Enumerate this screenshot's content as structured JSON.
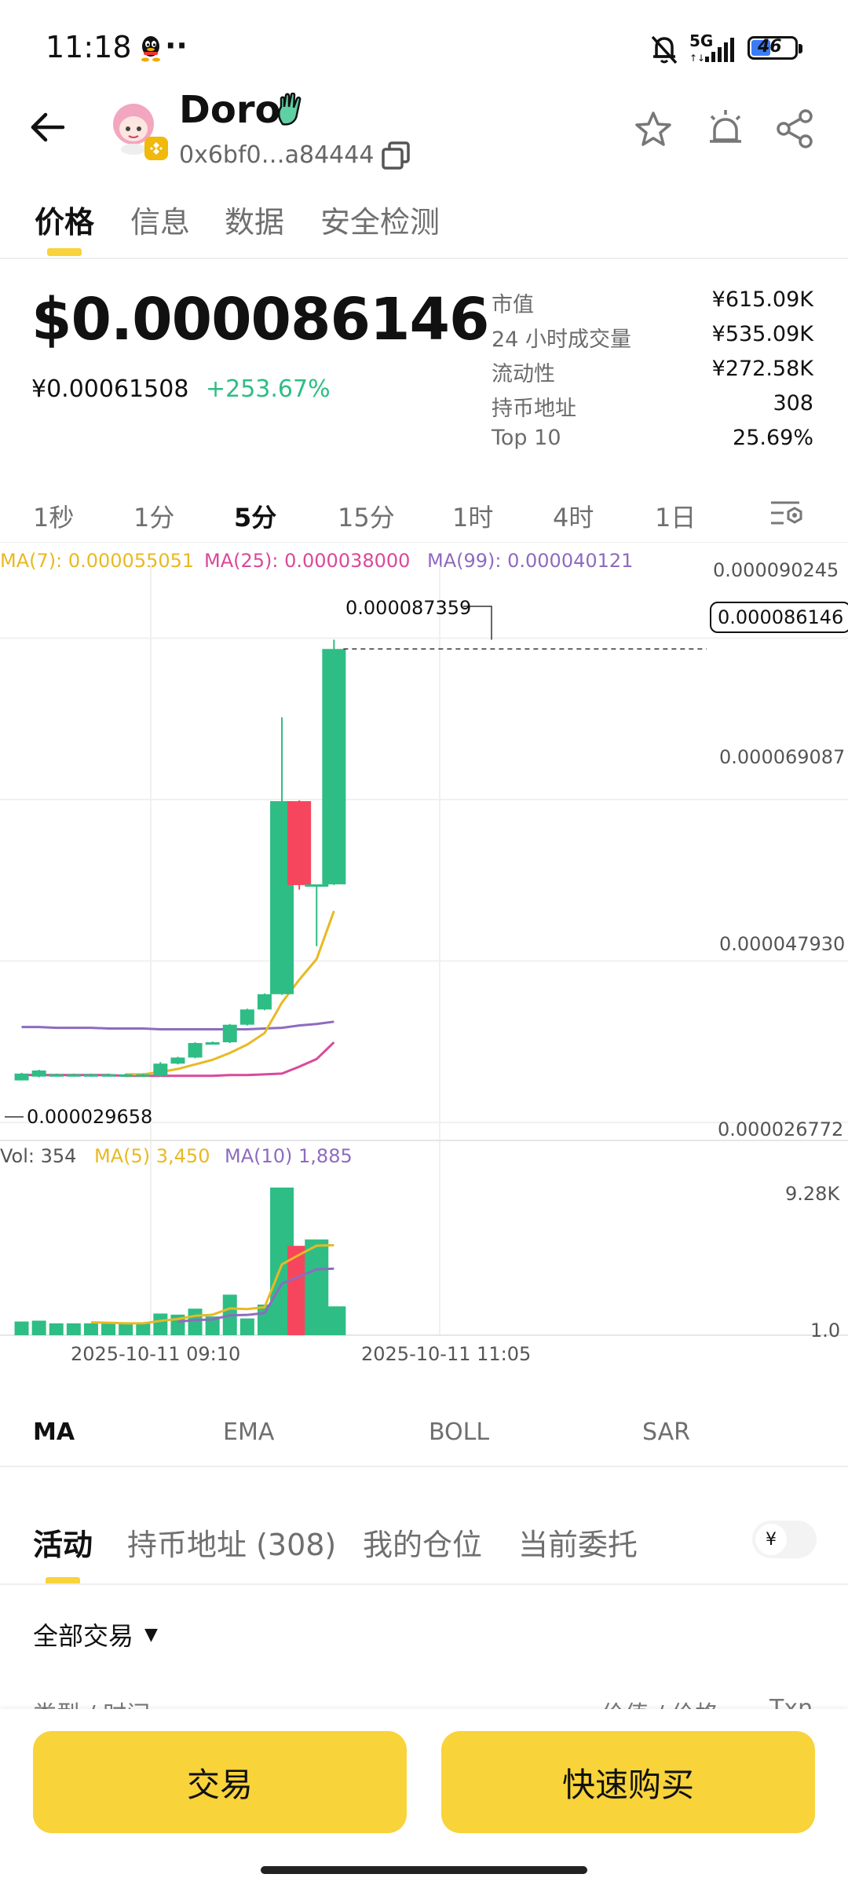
{
  "status_bar": {
    "time": "11:18",
    "dots": "··",
    "signal_label": "5G",
    "battery": "46"
  },
  "header": {
    "title": "Doro",
    "address": "0x6bf0…a84444"
  },
  "tabs": [
    {
      "label": "价格"
    },
    {
      "label": "信息"
    },
    {
      "label": "数据"
    },
    {
      "label": "安全检测"
    }
  ],
  "price": {
    "usd": "$0.000086146",
    "cny": "¥0.00061508",
    "change": "+253.67%"
  },
  "stats": [
    {
      "label": "市值",
      "value": "¥615.09K"
    },
    {
      "label": "24 小时成交量",
      "value": "¥535.09K"
    },
    {
      "label": "流动性",
      "value": "¥272.58K"
    },
    {
      "label": "持币地址",
      "value": "308"
    },
    {
      "label": "Top 10",
      "value": "25.69%"
    }
  ],
  "timeframes": [
    "1秒",
    "1分",
    "5分",
    "15分",
    "1时",
    "4时",
    "1日"
  ],
  "ma_legend": {
    "ma7": "MA(7): 0.000055051",
    "ma25": "MA(25): 0.000038000",
    "ma99": "MA(99): 0.000040121"
  },
  "price_axis": [
    "0.000090245",
    "0.000069087",
    "0.000047930",
    "0.000026772"
  ],
  "chart_annotations": {
    "high": "0.000087359",
    "low": "0.000029658",
    "current": "0.000086146"
  },
  "vol_legend": {
    "vol": "Vol: 354",
    "ma5": "MA(5) 3,450",
    "ma10": "MA(10) 1,885"
  },
  "vol_axis": [
    "9.28K",
    "1.0"
  ],
  "x_axis": [
    "2025-10-11 09:10",
    "2025-10-11 11:05"
  ],
  "indicators": [
    "MA",
    "EMA",
    "BOLL",
    "SAR"
  ],
  "activity_tabs": [
    "活动",
    "持币地址 (308)",
    "我的仓位",
    "当前委托"
  ],
  "currency_toggle": "¥",
  "filter": {
    "label": "全部交易"
  },
  "table_partial": {
    "left": "类型 / 时间",
    "mid": "价值 / 价格",
    "right": "Txn"
  },
  "buttons": {
    "trade": "交易",
    "quick_buy": "快速购买"
  },
  "colors": {
    "up": "#2ebd85",
    "down": "#f6465d",
    "accent": "#f8d33a",
    "ma7": "#e8b923",
    "ma25": "#d9499a",
    "ma99": "#8e6bbf"
  },
  "chart_data": {
    "type": "candlestick",
    "y_axis_ticks": [
      9.0245e-05,
      6.9087e-05,
      4.793e-05,
      2.6772e-05
    ],
    "ylim": [
      2.4e-05,
      9.4e-05
    ],
    "x_labels": [
      "2025-10-11 09:10",
      "2025-10-11 11:05"
    ],
    "candles": [
      {
        "o": 2.96e-05,
        "c": 3.05e-05,
        "h": 3.06e-05,
        "l": 2.96e-05
      },
      {
        "o": 3.01e-05,
        "c": 3.09e-05,
        "h": 3.1e-05,
        "l": 3e-05
      },
      {
        "o": 3.02e-05,
        "c": 3.04e-05,
        "h": 3.05e-05,
        "l": 3.01e-05
      },
      {
        "o": 3.02e-05,
        "c": 3.04e-05,
        "h": 3.05e-05,
        "l": 3.01e-05
      },
      {
        "o": 3.02e-05,
        "c": 3.04e-05,
        "h": 3.05e-05,
        "l": 3.01e-05
      },
      {
        "o": 3.02e-05,
        "c": 3.04e-05,
        "h": 3.05e-05,
        "l": 3.01e-05
      },
      {
        "o": 3.02e-05,
        "c": 3.04e-05,
        "h": 3.05e-05,
        "l": 3.01e-05
      },
      {
        "o": 3.02e-05,
        "c": 3.04e-05,
        "h": 3.05e-05,
        "l": 3.01e-05
      },
      {
        "o": 3.02e-05,
        "c": 3.18e-05,
        "h": 3.2e-05,
        "l": 3.01e-05
      },
      {
        "o": 3.18e-05,
        "c": 3.26e-05,
        "h": 3.27e-05,
        "l": 3.17e-05
      },
      {
        "o": 3.26e-05,
        "c": 3.45e-05,
        "h": 3.46e-05,
        "l": 3.25e-05
      },
      {
        "o": 3.45e-05,
        "c": 3.46e-05,
        "h": 3.47e-05,
        "l": 3.44e-05
      },
      {
        "o": 3.46e-05,
        "c": 3.69e-05,
        "h": 3.7e-05,
        "l": 3.45e-05
      },
      {
        "o": 3.69e-05,
        "c": 3.89e-05,
        "h": 3.9e-05,
        "l": 3.68e-05
      },
      {
        "o": 3.89e-05,
        "c": 4.09e-05,
        "h": 4.1e-05,
        "l": 3.88e-05
      },
      {
        "o": 4.09e-05,
        "c": 6.62e-05,
        "h": 7.72e-05,
        "l": 4.08e-05
      },
      {
        "o": 6.62e-05,
        "c": 5.52e-05,
        "h": 6.63e-05,
        "l": 5.46e-05
      },
      {
        "o": 5.52e-05,
        "c": 5.53e-05,
        "h": 5.53e-05,
        "l": 4.72e-05
      },
      {
        "o": 5.53e-05,
        "c": 8.6146e-05,
        "h": 8.7359e-05,
        "l": 5.52e-05
      }
    ],
    "ma7": [
      null,
      null,
      null,
      null,
      null,
      null,
      3.04e-05,
      3.04e-05,
      3.07e-05,
      3.11e-05,
      3.17e-05,
      3.23e-05,
      3.32e-05,
      3.43e-05,
      3.58e-05,
      3.98e-05,
      4.28e-05,
      4.55e-05,
      5.18e-05
    ],
    "ma25": [
      3.03e-05,
      3.03e-05,
      3.03e-05,
      3.03e-05,
      3.03e-05,
      3.03e-05,
      3.02e-05,
      3.02e-05,
      3.02e-05,
      3.02e-05,
      3.02e-05,
      3.02e-05,
      3.03e-05,
      3.03e-05,
      3.04e-05,
      3.05e-05,
      3.14e-05,
      3.24e-05,
      3.46e-05
    ],
    "ma99": [
      3.66e-05,
      3.66e-05,
      3.65e-05,
      3.65e-05,
      3.65e-05,
      3.64e-05,
      3.64e-05,
      3.64e-05,
      3.63e-05,
      3.63e-05,
      3.63e-05,
      3.63e-05,
      3.63e-05,
      3.63e-05,
      3.64e-05,
      3.65e-05,
      3.68e-05,
      3.7e-05,
      3.73e-05
    ],
    "volume": [
      80,
      90,
      60,
      60,
      60,
      60,
      60,
      60,
      200,
      180,
      300,
      150,
      700,
      120,
      400,
      9280,
      3400,
      3900,
      354
    ],
    "vol_ma5": [
      null,
      null,
      null,
      null,
      70,
      66,
      60,
      60,
      88,
      112,
      160,
      178,
      306,
      290,
      334,
      2134,
      2754,
      3410,
      3450
    ],
    "vol_ma10": [
      null,
      null,
      null,
      null,
      null,
      null,
      null,
      null,
      null,
      77,
      99,
      105,
      169,
      175,
      209,
      1132,
      1466,
      1845,
      1885
    ]
  }
}
